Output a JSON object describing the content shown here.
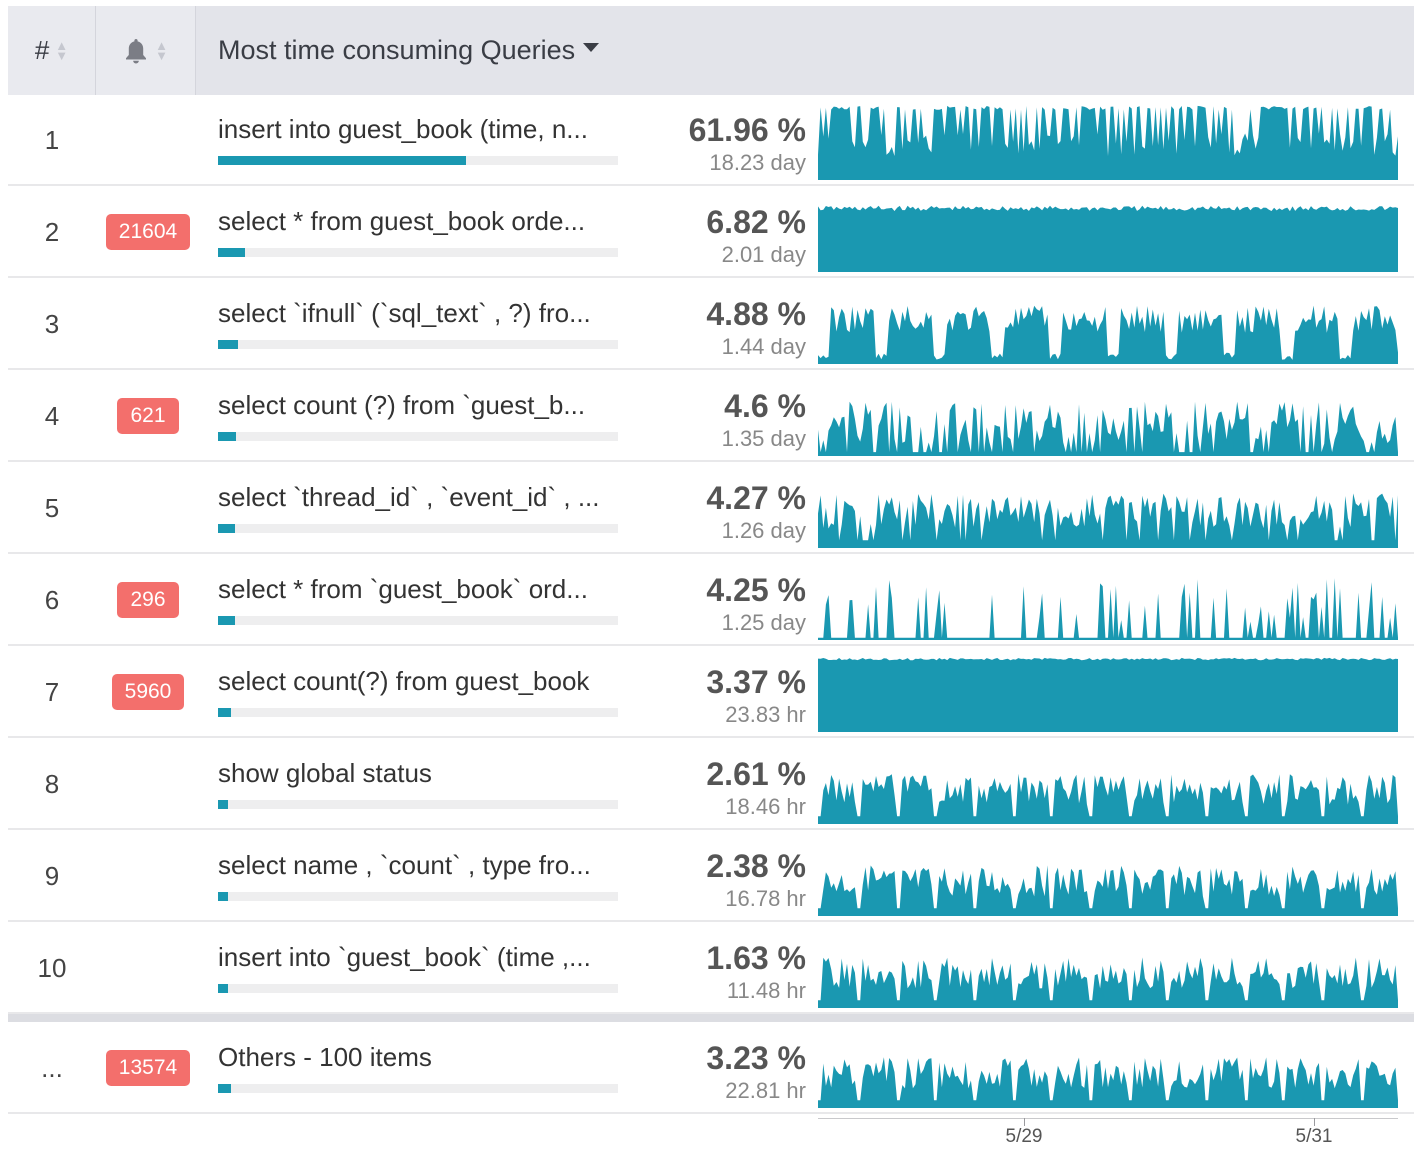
{
  "header": {
    "rank_label": "#",
    "title": "Most time consuming Queries"
  },
  "colors": {
    "accent": "#1a98b1",
    "badge": "#f36f6c",
    "header_bg": "#e3e4ea"
  },
  "icons": {
    "bell": "bell-icon",
    "sort": "sort-icon",
    "dropdown": "caret-down-icon"
  },
  "rows": [
    {
      "rank": "1",
      "badge": "",
      "query": "insert into guest_book (time, n...",
      "pct": "61.96 %",
      "duration": "18.23 day",
      "bar_fraction": 0.6196
    },
    {
      "rank": "2",
      "badge": "21604",
      "query": "select * from guest_book orde...",
      "pct": "6.82 %",
      "duration": "2.01 day",
      "bar_fraction": 0.0682
    },
    {
      "rank": "3",
      "badge": "",
      "query": "select `ifnull` (`sql_text` , ?) fro...",
      "pct": "4.88 %",
      "duration": "1.44 day",
      "bar_fraction": 0.0488
    },
    {
      "rank": "4",
      "badge": "621",
      "query": "select count (?) from `guest_b...",
      "pct": "4.6 %",
      "duration": "1.35 day",
      "bar_fraction": 0.046
    },
    {
      "rank": "5",
      "badge": "",
      "query": "select `thread_id` , `event_id` , ...",
      "pct": "4.27 %",
      "duration": "1.26 day",
      "bar_fraction": 0.0427
    },
    {
      "rank": "6",
      "badge": "296",
      "query": "select * from `guest_book` ord...",
      "pct": "4.25 %",
      "duration": "1.25 day",
      "bar_fraction": 0.0425
    },
    {
      "rank": "7",
      "badge": "5960",
      "query": "select count(?) from guest_book",
      "pct": "3.37 %",
      "duration": "23.83 hr",
      "bar_fraction": 0.0337
    },
    {
      "rank": "8",
      "badge": "",
      "query": "show global status",
      "pct": "2.61 %",
      "duration": "18.46 hr",
      "bar_fraction": 0.0261
    },
    {
      "rank": "9",
      "badge": "",
      "query": "select name , `count` , type fro...",
      "pct": "2.38 %",
      "duration": "16.78 hr",
      "bar_fraction": 0.0238
    },
    {
      "rank": "10",
      "badge": "",
      "query": "insert into `guest_book` (time ,...",
      "pct": "1.63 %",
      "duration": "11.48 hr",
      "bar_fraction": 0.0163
    }
  ],
  "others": {
    "rank": "...",
    "badge": "13574",
    "query": "Others - 100 items",
    "pct": "3.23 %",
    "duration": "22.81 hr",
    "bar_fraction": 0.0323
  },
  "axis": {
    "ticks": [
      "5/29",
      "5/31"
    ]
  }
}
